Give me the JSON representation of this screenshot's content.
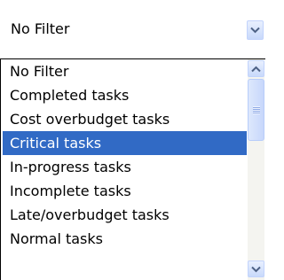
{
  "combo": {
    "selected_value": "No Filter",
    "arrow_icon": "chevron-down-icon"
  },
  "dropdown": {
    "options": [
      {
        "label": "No Filter",
        "selected": false
      },
      {
        "label": "Completed tasks",
        "selected": false
      },
      {
        "label": "Cost overbudget tasks",
        "selected": false
      },
      {
        "label": "Critical tasks",
        "selected": true
      },
      {
        "label": "In-progress tasks",
        "selected": false
      },
      {
        "label": "Incomplete tasks",
        "selected": false
      },
      {
        "label": "Late/overbudget tasks",
        "selected": false
      },
      {
        "label": "Normal tasks",
        "selected": false
      }
    ],
    "scrollbar": {
      "up_icon": "chevron-up-icon",
      "down_icon": "chevron-down-icon",
      "thumb_icon": "scroll-grip-icon"
    }
  },
  "colors": {
    "selection_background": "#316ac5",
    "selection_text": "#ffffff",
    "arrow": "#4d6185"
  }
}
